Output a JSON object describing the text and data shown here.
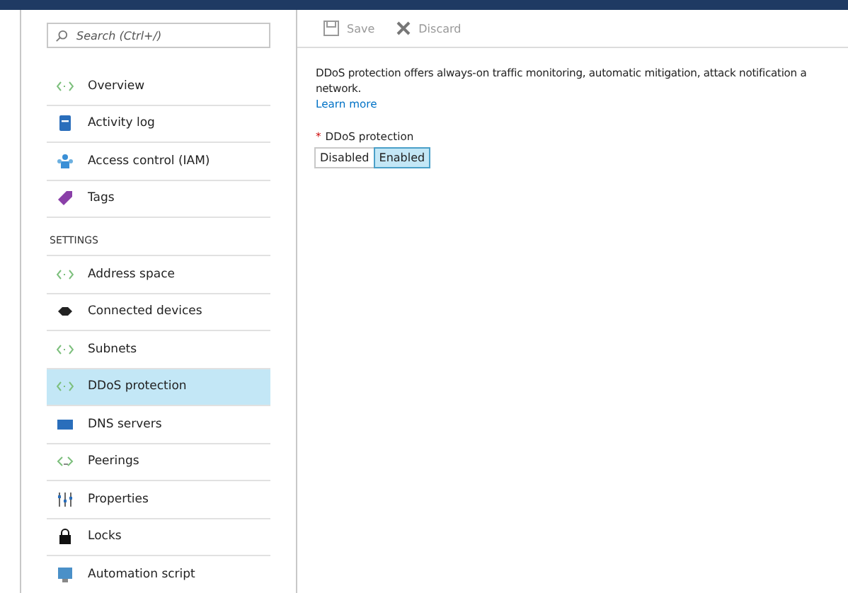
{
  "sidebar": {
    "search": {
      "placeholder": "Search (Ctrl+/)"
    },
    "groups": [
      {
        "items": [
          {
            "label": "Overview",
            "kind": "code",
            "selected": false
          },
          {
            "label": "Activity log",
            "kind": "log",
            "selected": false
          },
          {
            "label": "Access control (IAM)",
            "kind": "people",
            "selected": false
          },
          {
            "label": "Tags",
            "kind": "tag",
            "selected": false
          }
        ]
      },
      {
        "heading": "SETTINGS",
        "items": [
          {
            "label": "Address space",
            "kind": "code",
            "selected": false
          },
          {
            "label": "Connected devices",
            "kind": "device",
            "selected": false
          },
          {
            "label": "Subnets",
            "kind": "code",
            "selected": false
          },
          {
            "label": "DDoS protection",
            "kind": "code",
            "selected": true
          },
          {
            "label": "DNS servers",
            "kind": "dns",
            "selected": false
          },
          {
            "label": "Peerings",
            "kind": "peer",
            "selected": false
          },
          {
            "label": "Properties",
            "kind": "props",
            "selected": false
          },
          {
            "label": "Locks",
            "kind": "lock",
            "selected": false
          },
          {
            "label": "Automation script",
            "kind": "script",
            "selected": false
          }
        ]
      }
    ]
  },
  "toolbar": [
    {
      "label": "Save",
      "kind": "save",
      "disabled": true
    },
    {
      "label": "Discard",
      "kind": "close",
      "disabled": true
    }
  ],
  "description_lines": [
    "DDoS protection offers always-on traffic monitoring, automatic mitigation, attack notification a",
    "network."
  ],
  "learn_more": "Learn more",
  "field": {
    "label": "DDoS protection",
    "required_mark": "*",
    "options": [
      {
        "label": "Disabled",
        "selected": false
      },
      {
        "label": "Enabled",
        "selected": true
      }
    ]
  }
}
